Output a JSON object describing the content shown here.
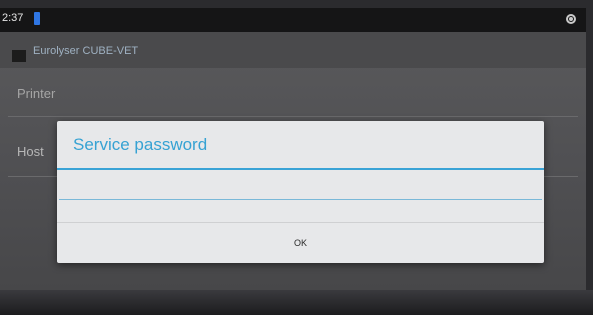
{
  "status_bar": {
    "time": "2:37",
    "notification_icon": "notification-icon",
    "sync_icon": "sync-icon"
  },
  "app": {
    "title": "Eurolyser CUBE-VET",
    "icon": "app-icon"
  },
  "settings": {
    "printer_label": "Printer",
    "host_label": "Host"
  },
  "dialog": {
    "title": "Service password",
    "password_value": "",
    "ok_label": "OK"
  },
  "colors": {
    "accent": "#36a2d3",
    "notification": "#2f76e3"
  }
}
